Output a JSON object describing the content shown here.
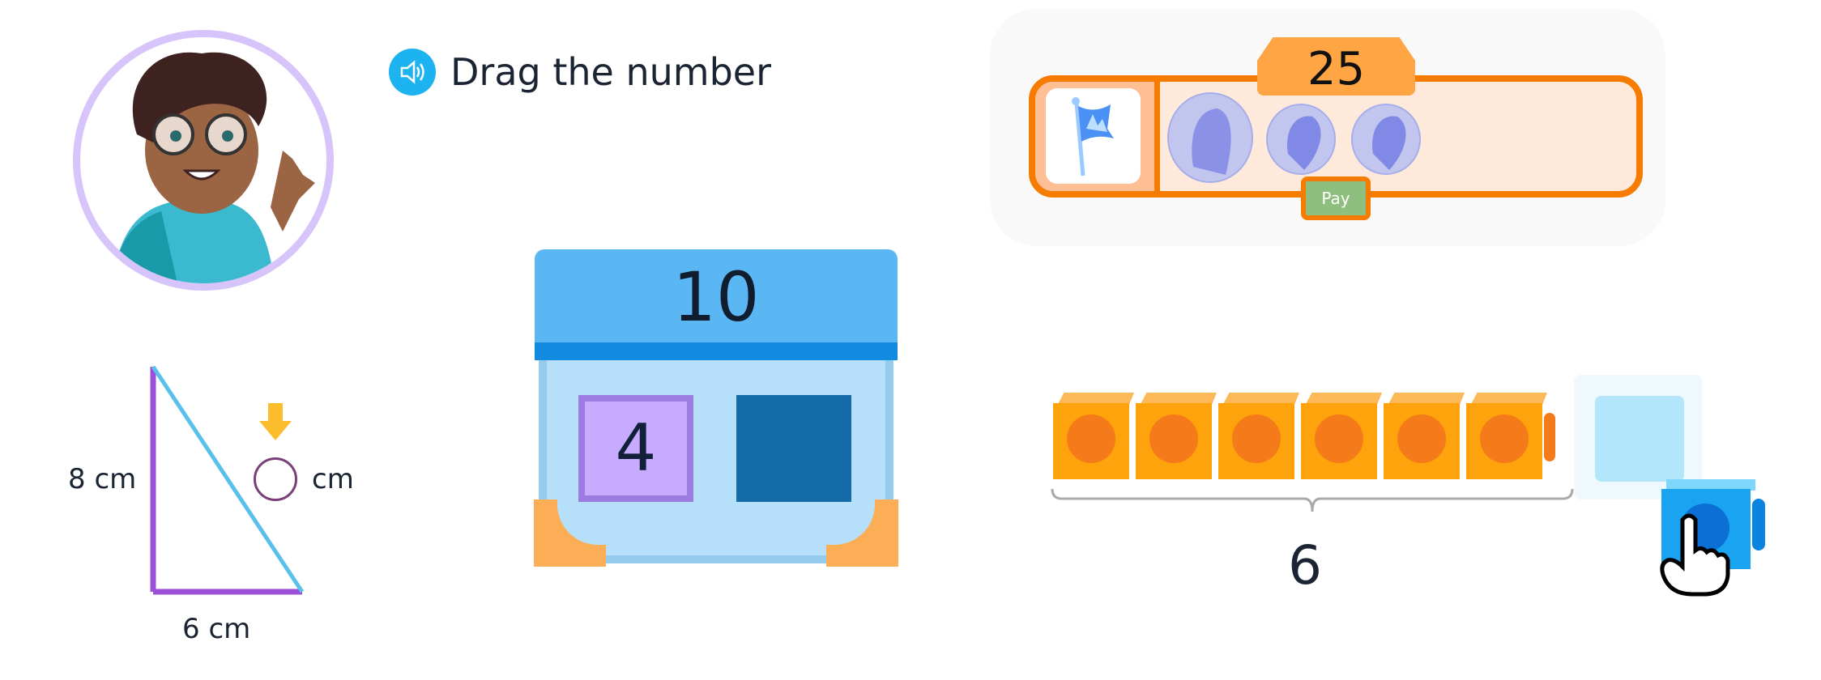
{
  "instruction": {
    "text": "Drag the number",
    "icon": "speaker-icon"
  },
  "store": {
    "price": "25",
    "item_icon": "flag-icon",
    "coins": [
      "nickel",
      "dime",
      "dime"
    ],
    "pay_label": "Pay"
  },
  "triangle": {
    "height_label": "8 cm",
    "base_label": "6 cm",
    "answer_unit": "cm",
    "answer_value": ""
  },
  "ten_frame": {
    "total": "10",
    "known_part": "4",
    "missing_part": ""
  },
  "cubes": {
    "count_label": "6",
    "count": 6
  },
  "colors": {
    "accent_orange": "#f57c00",
    "cube_orange": "#fea30b",
    "frame_blue": "#5bb7f4",
    "purple": "#9c4fd6",
    "speaker_blue": "#1db3f0"
  }
}
